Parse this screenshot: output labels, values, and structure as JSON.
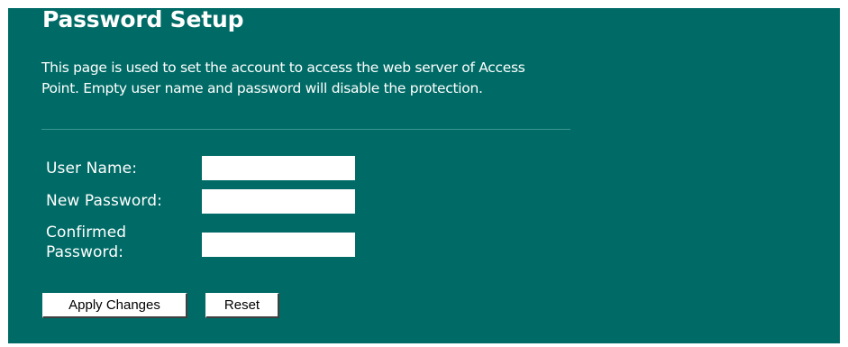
{
  "page": {
    "title": "Password Setup",
    "description": "This page is used to set the account to access the web server of Access Point. Empty user name and password will disable the protection."
  },
  "form": {
    "user_name_label": "User Name:",
    "user_name_value": "",
    "new_password_label": "New Password:",
    "new_password_value": "",
    "confirmed_password_label": "Confirmed Password:",
    "confirmed_password_value": ""
  },
  "buttons": {
    "apply_label": "Apply Changes",
    "reset_label": "Reset"
  },
  "colors": {
    "background": "#006b66",
    "text": "#ffffff",
    "divider": "#3b958f",
    "input_background": "#ffffff"
  }
}
